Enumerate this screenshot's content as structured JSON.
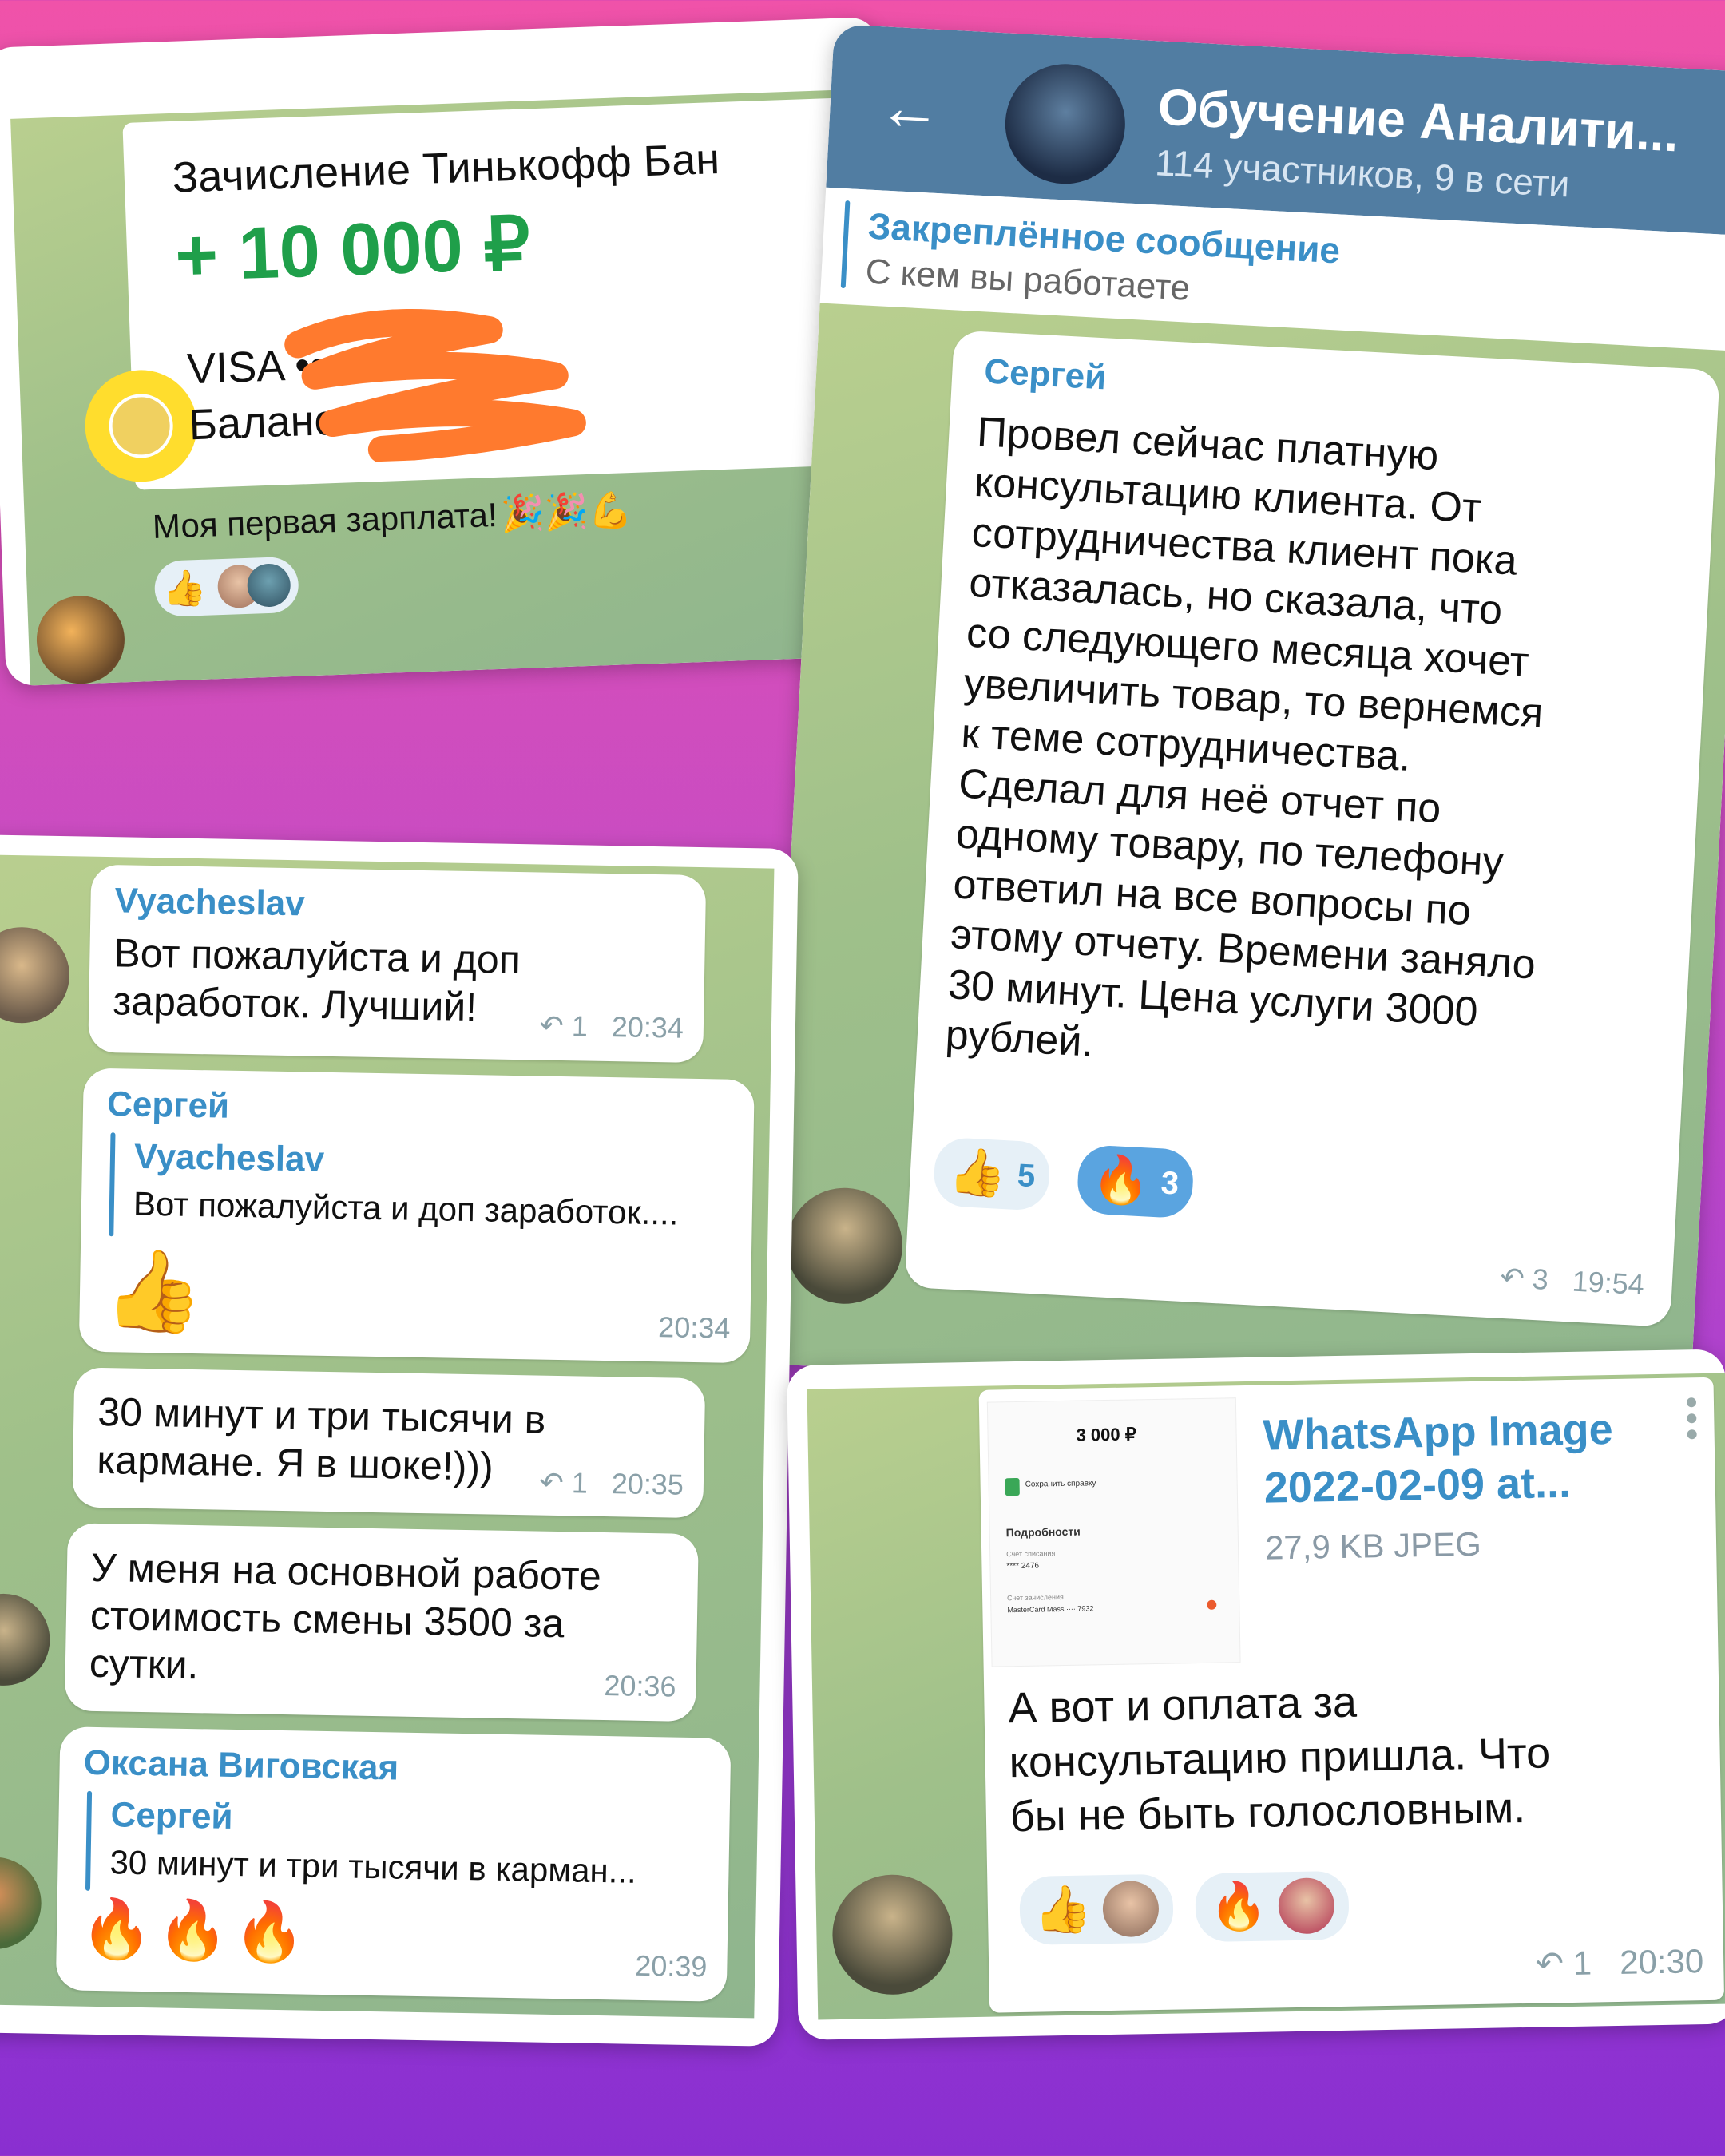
{
  "card1": {
    "title": "Зачисление Тинькофф Бан",
    "amount": "+ 10 000 ₽",
    "card_label": "VISA ••",
    "balance_label": "Баланс:",
    "caption": "Моя первая зарплата!",
    "caption_emoji": "🎉🎉💪",
    "reaction_emoji": "👍"
  },
  "card2": {
    "header": {
      "title": "Обучение Аналити...",
      "subtitle": "114 участников, 9 в сети",
      "back_icon": "arrow-left"
    },
    "pinned": {
      "label": "Закреплённое сообщение",
      "text": "С кем вы работаете"
    },
    "message": {
      "sender": "Сергей",
      "lines": [
        "Провел сейчас платную",
        "консультацию клиента. От",
        "сотрудничества клиент пока",
        "отказалась, но сказала, что",
        "со следующего месяца хочет",
        "увеличить товар, то вернемся",
        "к теме сотрудничества.",
        "Сделал для неё отчет по",
        "одному товару, по телефону",
        "ответил на все вопросы по",
        "этому отчету. Времени заняло",
        "30 минут. Цена услуги 3000",
        "рублей."
      ],
      "reactions": [
        {
          "emoji": "👍",
          "count": "5"
        },
        {
          "emoji": "🔥",
          "count": "3"
        }
      ],
      "replies": "3",
      "time": "19:54"
    }
  },
  "card3": {
    "messages": [
      {
        "sender": "Vyacheslav",
        "line1": "Вот пожалуйста и доп",
        "line2": "заработок. Лучший!",
        "replies": "1",
        "time": "20:34"
      },
      {
        "sender": "Сергей",
        "reply_to": "Vyacheslav",
        "reply_text": "Вот пожалуйста и доп заработок....",
        "emoji": "👍",
        "time": "20:34"
      },
      {
        "line1": "30 минут и три тысячи в",
        "line2": "кармане. Я в шоке!)))",
        "replies": "1",
        "time": "20:35"
      },
      {
        "line1": "У меня на основной работе",
        "line2": "стоимость смены 3500 за",
        "line3": "сутки.",
        "time": "20:36"
      },
      {
        "sender": "Оксана Виговская",
        "reply_to": "Сергей",
        "reply_text": "30 минут и три тысячи в карман...",
        "emoji": "🔥🔥🔥",
        "time": "20:39"
      }
    ]
  },
  "card4": {
    "thumb": {
      "amount": "3 000 ₽",
      "save": "Сохранить справку",
      "details": "Подробности",
      "acc_label": "Счет списания",
      "acc_value": "**** 2476",
      "dest_label": "Счет зачисления",
      "dest_value": "MasterCard Mass ···· 7932"
    },
    "file": {
      "name_line1": "WhatsApp Image",
      "name_line2": "2022-02-09 at...",
      "size": "27,9 KB JPEG"
    },
    "text_lines": [
      "А вот и оплата за",
      "консультацию пришла. Что",
      "бы не быть голословным."
    ],
    "reactions": [
      "👍",
      "🔥"
    ],
    "replies": "1",
    "time": "20:30"
  }
}
